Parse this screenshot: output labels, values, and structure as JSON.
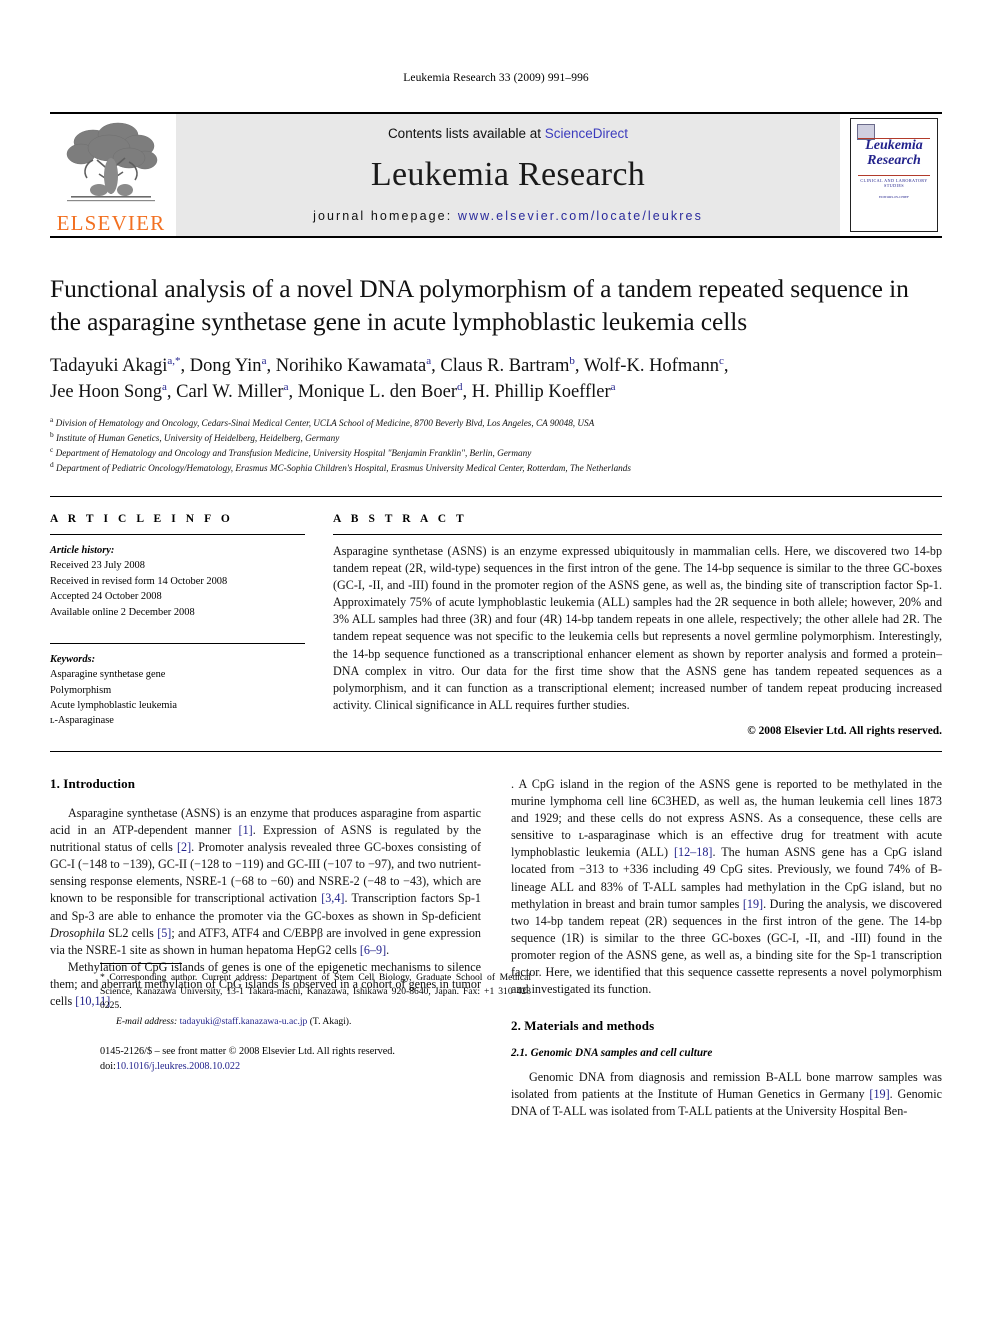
{
  "running_head": "Leukemia Research 33 (2009) 991–996",
  "masthead": {
    "publisher_logo_text": "ELSEVIER",
    "contents_prefix": "Contents lists available at ",
    "contents_link": "ScienceDirect",
    "journal_name": "Leukemia Research",
    "homepage_prefix": "journal homepage: ",
    "homepage_url": "www.elsevier.com/locate/leukres",
    "cover": {
      "title_line1": "Leukemia",
      "title_line2": "Research",
      "subtitle": "CLINICAL AND LABORATORY STUDIES",
      "editors_label": "EDITORS-IN-CHIEF",
      "editors": "John M. Bennett    Terry J. Hamblin\nUSA                        UK"
    }
  },
  "title": "Functional analysis of a novel DNA polymorphism of a tandem repeated sequence in the asparagine synthetase gene in acute lymphoblastic leukemia cells",
  "authors": [
    {
      "name": "Tadayuki Akagi",
      "sup": "a,*"
    },
    {
      "name": "Dong Yin",
      "sup": "a"
    },
    {
      "name": "Norihiko Kawamata",
      "sup": "a"
    },
    {
      "name": "Claus R. Bartram",
      "sup": "b"
    },
    {
      "name": "Wolf-K. Hofmann",
      "sup": "c"
    },
    {
      "name": "Jee Hoon Song",
      "sup": "a"
    },
    {
      "name": "Carl W. Miller",
      "sup": "a"
    },
    {
      "name": "Monique L. den Boer",
      "sup": "d"
    },
    {
      "name": "H. Phillip Koeffler",
      "sup": "a"
    }
  ],
  "affiliations": [
    {
      "mark": "a",
      "text": "Division of Hematology and Oncology, Cedars-Sinai Medical Center, UCLA School of Medicine, 8700 Beverly Blvd, Los Angeles, CA 90048, USA"
    },
    {
      "mark": "b",
      "text": "Institute of Human Genetics, University of Heidelberg, Heidelberg, Germany"
    },
    {
      "mark": "c",
      "text": "Department of Hematology and Oncology and Transfusion Medicine, University Hospital \"Benjamin Franklin\", Berlin, Germany"
    },
    {
      "mark": "d",
      "text": "Department of Pediatric Oncology/Hematology, Erasmus MC-Sophia Children's Hospital, Erasmus University Medical Center, Rotterdam, The Netherlands"
    }
  ],
  "article_info": {
    "heading": "A R T I C L E   I N F O",
    "history_label": "Article history:",
    "history": [
      "Received 23 July 2008",
      "Received in revised form 14 October 2008",
      "Accepted 24 October 2008",
      "Available online 2 December 2008"
    ],
    "keywords_label": "Keywords:",
    "keywords": [
      "Asparagine synthetase gene",
      "Polymorphism",
      "Acute lymphoblastic leukemia",
      "ʟ-Asparaginase"
    ]
  },
  "abstract": {
    "heading": "A B S T R A C T",
    "text": "Asparagine synthetase (ASNS) is an enzyme expressed ubiquitously in mammalian cells. Here, we discovered two 14-bp tandem repeat (2R, wild-type) sequences in the first intron of the gene. The 14-bp sequence is similar to the three GC-boxes (GC-I, -II, and -III) found in the promoter region of the ASNS gene, as well as, the binding site of transcription factor Sp-1. Approximately 75% of acute lymphoblastic leukemia (ALL) samples had the 2R sequence in both allele; however, 20% and 3% ALL samples had three (3R) and four (4R) 14-bp tandem repeats in one allele, respectively; the other allele had 2R. The tandem repeat sequence was not specific to the leukemia cells but represents a novel germline polymorphism. Interestingly, the 14-bp sequence functioned as a transcriptional enhancer element as shown by reporter analysis and formed a protein–DNA complex in vitro. Our data for the first time show that the ASNS gene has tandem repeated sequences as a polymorphism, and it can function as a transcriptional element; increased number of tandem repeat producing increased activity. Clinical significance in ALL requires further studies.",
    "copyright": "© 2008 Elsevier Ltd. All rights reserved."
  },
  "sections": {
    "introduction_heading": "1.  Introduction",
    "intro_p1_a": "Asparagine synthetase (ASNS) is an enzyme that produces asparagine from aspartic acid in an ATP-dependent manner ",
    "intro_p1_r1": "[1]",
    "intro_p1_b": ". Expression of ASNS is regulated by the nutritional status of cells ",
    "intro_p1_r2": "[2]",
    "intro_p1_c": ". Promoter analysis revealed three GC-boxes consisting of GC-I (−148 to −139), GC-II (−128 to −119) and GC-III (−107 to −97), and two nutrient-sensing response elements, NSRE-1 (−68 to −60) and NSRE-2 (−48 to −43), which are known to be responsible for transcriptional activation ",
    "intro_p1_r3": "[3,4]",
    "intro_p1_d": ". Transcription factors Sp-1 and Sp-3 are able to enhance the promoter via the GC-boxes as shown in Sp-deficient ",
    "intro_p1_ital": "Drosophila",
    "intro_p1_e": " SL2 cells ",
    "intro_p1_r4": "[5]",
    "intro_p1_f": "; and ATF3, ATF4 and C/EBPβ are involved in gene expression via the NSRE-1 site as shown in human hepatoma HepG2 cells ",
    "intro_p1_r5": "[6–9]",
    "intro_p1_g": ".",
    "intro_p2_a": "Methylation of CpG islands of genes is one of the epigenetic mechanisms to silence them; and aberrant methylation of CpG islands is observed in a cohort of genes in tumor cells ",
    "intro_p2_r1": "[10,11]",
    "intro_p2_b": ". A CpG island in the region of the ASNS gene is reported to be methylated in the murine lymphoma cell line 6C3HED, as well as, the human leukemia cell lines 1873 and 1929; and these cells do not express ASNS. As a consequence, these cells are sensitive to ʟ-asparaginase which is an effective drug for treatment with acute lymphoblastic leukemia (ALL) ",
    "intro_p2_r2": "[12–18]",
    "intro_p2_c": ". The human ASNS gene has a CpG island located from −313 to +336 including 49 CpG sites. Previously, we found 74% of B-lineage ALL and 83% of T-ALL samples had methylation in the CpG island, but no methylation in breast and brain tumor samples ",
    "intro_p2_r3": "[19]",
    "intro_p2_d": ". During the analysis, we discovered two 14-bp tandem repeat (2R) sequences in the first intron of the gene. The 14-bp sequence (1R) is similar to the three GC-boxes (GC-I, -II, and -III) found in the promoter region of the ASNS gene, as well as, a binding site for the Sp-1 transcription factor. Here, we identified that this sequence cassette represents a novel polymorphism and investigated its function.",
    "materials_heading": "2.  Materials and methods",
    "subsec_2_1_heading": "2.1.  Genomic DNA samples and cell culture",
    "materials_p1_a": "Genomic DNA from diagnosis and remission B-ALL bone marrow samples was isolated from patients at the Institute of Human Genetics in Germany ",
    "materials_p1_r1": "[19]",
    "materials_p1_b": ". Genomic DNA of T-ALL was isolated from T-ALL patients at the University Hospital Ben-"
  },
  "footnote": {
    "corresponding": "*  Corresponding author. Current address: Department of Stem Cell Biology, Graduate School of Medical Science, Kanazawa University, 13-1 Takara-machi, Kanazawa, Ishikawa 920-8640, Japan. Fax: +1 310 423 0225.",
    "email_label": "E-mail address:",
    "email_address": "tadayuki@staff.kanazawa-u.ac.jp",
    "email_suffix": " (T. Akagi).",
    "issn_line": "0145-2126/$ – see front matter © 2008 Elsevier Ltd. All rights reserved.",
    "doi_label": "doi:",
    "doi_value": "10.1016/j.leukres.2008.10.022"
  },
  "colors": {
    "link_blue": "#23238c",
    "elsevier_orange": "#F27021",
    "band_gray": "#e8e8e8",
    "cover_red": "#b23b2b"
  }
}
